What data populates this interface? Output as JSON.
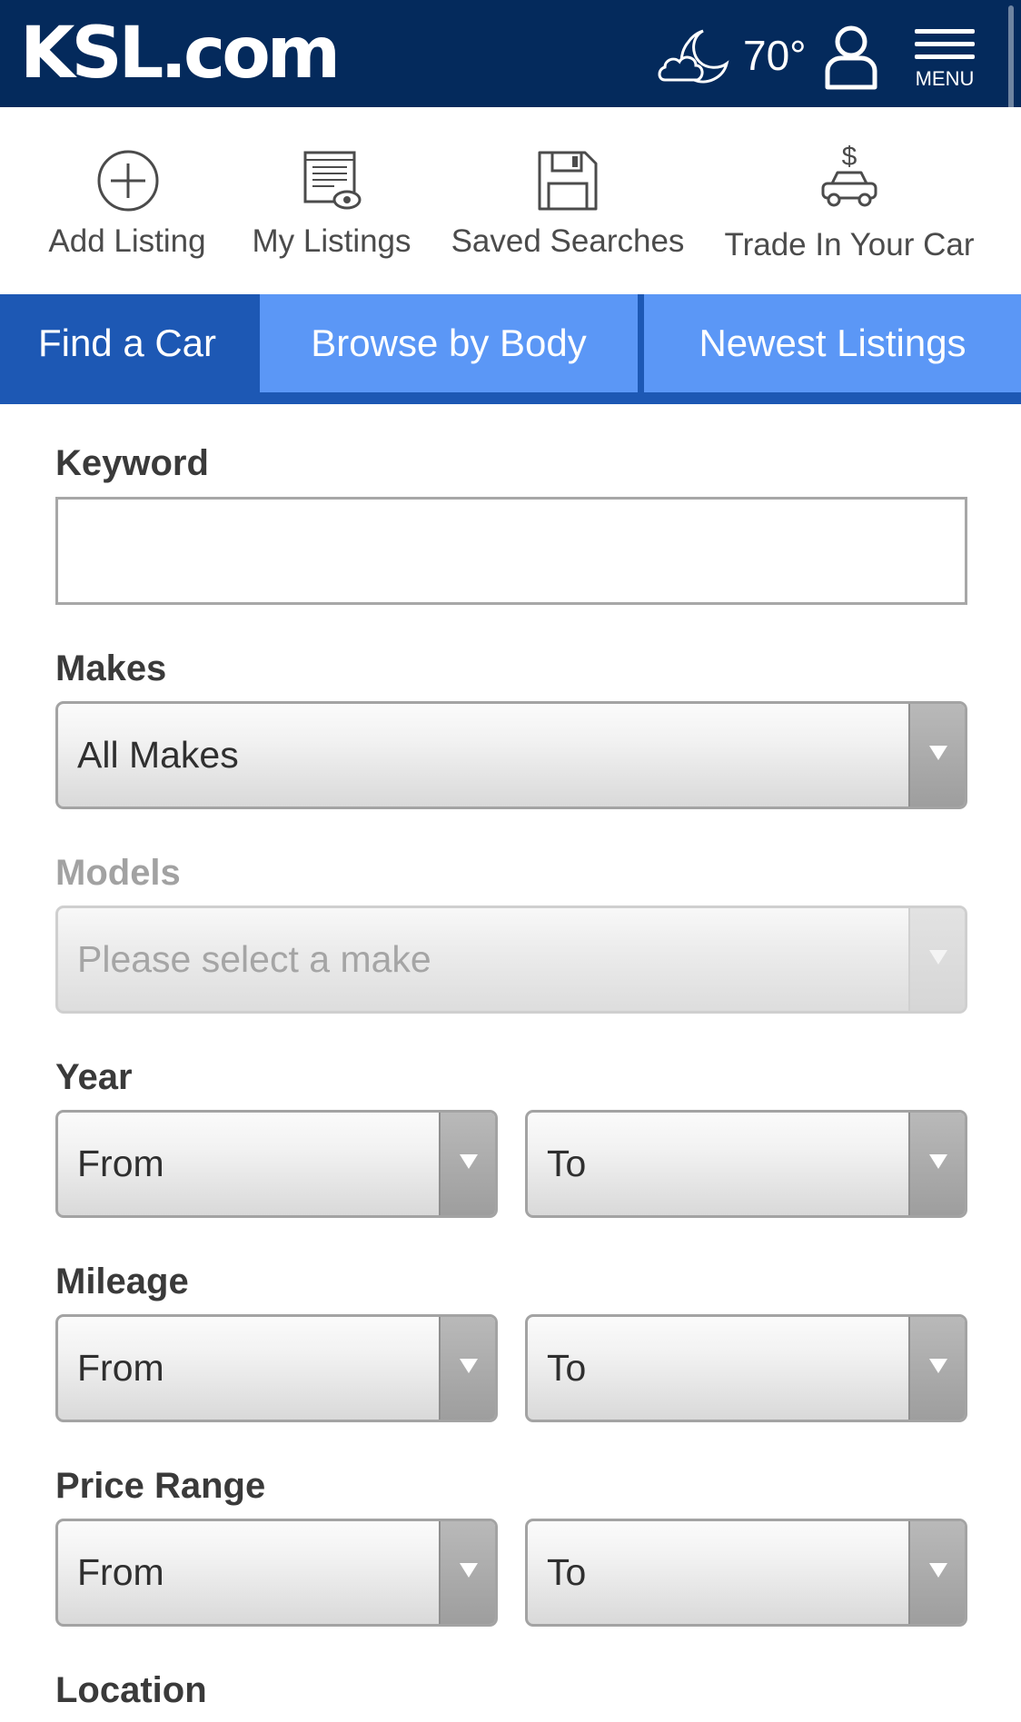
{
  "header": {
    "logo": "KSL.com",
    "temperature": "70°",
    "weather_icon": "cloud-moon-icon",
    "account_icon": "user-icon",
    "menu_label": "MENU",
    "background": "#042a5c"
  },
  "actions": [
    {
      "label": "Add Listing",
      "icon": "add-circle-icon"
    },
    {
      "label": "My Listings",
      "icon": "my-listings-icon"
    },
    {
      "label": "Saved Searches",
      "icon": "floppy-disk-icon"
    },
    {
      "label": "Trade In Your Car",
      "icon": "car-dollar-icon"
    }
  ],
  "tabs": [
    {
      "label": "Find a Car",
      "active": true
    },
    {
      "label": "Browse by Body",
      "active": false
    },
    {
      "label": "Newest Listings",
      "active": false
    }
  ],
  "form": {
    "keyword": {
      "label": "Keyword",
      "value": ""
    },
    "makes": {
      "label": "Makes",
      "selected": "All Makes"
    },
    "models": {
      "label": "Models",
      "selected": "Please select a make",
      "disabled": true
    },
    "year": {
      "label": "Year",
      "from": "From",
      "to": "To"
    },
    "mileage": {
      "label": "Mileage",
      "from": "From",
      "to": "To"
    },
    "price": {
      "label": "Price Range",
      "from": "From",
      "to": "To"
    },
    "location": {
      "label": "Location"
    }
  },
  "colors": {
    "tab_active": "#1d58b4",
    "tab_inactive": "#5b97f6"
  }
}
